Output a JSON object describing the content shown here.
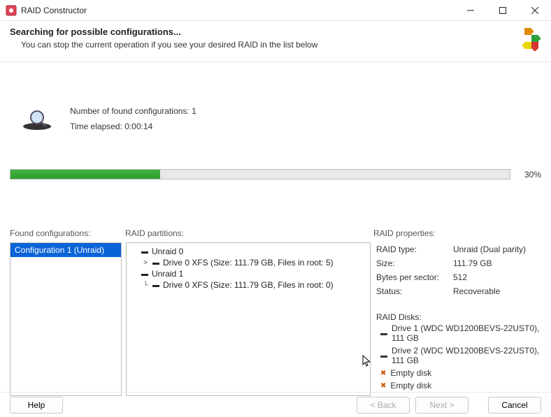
{
  "window": {
    "title": "RAID Constructor"
  },
  "header": {
    "title": "Searching for possible configurations...",
    "subtitle": "You can stop the current operation if you see your desired RAID in the list below"
  },
  "status": {
    "found_label": "Number of found configurations:",
    "found_count": "1",
    "elapsed_label": "Time elapsed:",
    "elapsed_value": "0:00:14"
  },
  "progress": {
    "percent": "30%",
    "width": "30%"
  },
  "labels": {
    "found": "Found configurations:",
    "partitions": "RAID partitions:",
    "properties": "RAID properties:"
  },
  "found_list": [
    {
      "label": "Configuration 1 (Unraid)",
      "selected": true
    }
  ],
  "tree": [
    {
      "level": 0,
      "expander": "",
      "icon": "disk",
      "label": "Unraid 0"
    },
    {
      "level": 1,
      "expander": ">",
      "icon": "disk",
      "label": "Drive 0 XFS (Size: 111.79 GB, Files in root: 5)"
    },
    {
      "level": 0,
      "expander": "",
      "icon": "disk",
      "label": "Unraid 1"
    },
    {
      "level": 1,
      "expander": "└",
      "icon": "disk",
      "label": "Drive 0 XFS (Size: 111.79 GB, Files in root: 0)"
    }
  ],
  "props": {
    "type_k": "RAID type:",
    "type_v": "Unraid (Dual parity)",
    "size_k": "Size:",
    "size_v": "111.79 GB",
    "bps_k": "Bytes per sector:",
    "bps_v": "512",
    "status_k": "Status:",
    "status_v": "Recoverable"
  },
  "disks": {
    "header": "RAID Disks:",
    "items": [
      {
        "present": true,
        "label": "Drive 1 (WDC WD1200BEVS-22UST0), 111 GB"
      },
      {
        "present": true,
        "label": "Drive 2 (WDC WD1200BEVS-22UST0), 111 GB"
      },
      {
        "present": false,
        "label": "Empty disk"
      },
      {
        "present": false,
        "label": "Empty disk"
      }
    ]
  },
  "footer": {
    "help": "Help",
    "back": "< Back",
    "next": "Next >",
    "cancel": "Cancel"
  }
}
